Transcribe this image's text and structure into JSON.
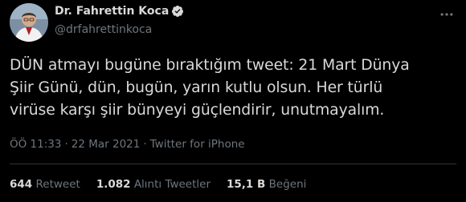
{
  "author": {
    "name": "Dr. Fahrettin Koca",
    "handle": "@drfahrettinkoca",
    "verified": true
  },
  "tweet": {
    "lines": [
      "DÜN atmayı bugüne bıraktığım tweet: 21 Mart Dünya",
      "Şiir Günü, dün, bugün, yarın kutlu olsun. Her türlü",
      "virüse karşı şiir bünyeyi güçlendirir, unutmayalım."
    ]
  },
  "meta": {
    "time": "ÖÖ 11:33",
    "date": "22 Mar 2021",
    "source": "Twitter for iPhone",
    "separator": "·"
  },
  "stats": {
    "retweets_count": "644",
    "retweets_label": "Retweet",
    "quotes_count": "1.082",
    "quotes_label": "Alıntı Tweetler",
    "likes_count": "15,1 B",
    "likes_label": "Beğeni"
  },
  "colors": {
    "background": "#000000",
    "text": "#d9d9d9",
    "secondary": "#6e767d",
    "verified": "#1d9bf0"
  },
  "icons": {
    "verified": "verified-badge-icon",
    "more": "more-options-icon"
  }
}
